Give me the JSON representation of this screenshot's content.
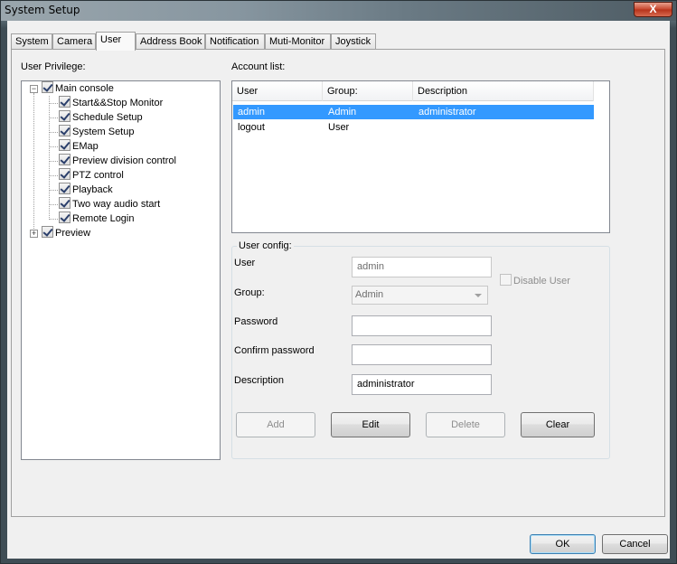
{
  "window": {
    "title": "System Setup",
    "close_glyph": "X"
  },
  "tabs": [
    {
      "label": "System"
    },
    {
      "label": "Camera"
    },
    {
      "label": "User"
    },
    {
      "label": "Address Book"
    },
    {
      "label": "Notification"
    },
    {
      "label": "Muti-Monitor"
    },
    {
      "label": "Joystick"
    }
  ],
  "privilege": {
    "label": "User Privilege:",
    "root": {
      "label": "Main console",
      "expander": "−"
    },
    "children": [
      "Start&&Stop Monitor",
      "Schedule Setup",
      "System Setup",
      "EMap",
      "Preview division control",
      "PTZ control",
      "Playback",
      "Two way audio start",
      "Remote Login"
    ],
    "preview": {
      "label": "Preview",
      "expander": "+"
    }
  },
  "accounts": {
    "label": "Account list:",
    "columns": [
      "User",
      "Group:",
      "Description"
    ],
    "rows": [
      {
        "user": "admin",
        "group": "Admin",
        "description": "administrator"
      },
      {
        "user": "logout",
        "group": "User",
        "description": ""
      }
    ]
  },
  "config": {
    "title": "User config:",
    "user_label": "User",
    "user_value": "admin",
    "disable_user_label": "Disable User",
    "group_label": "Group:",
    "group_value": "Admin",
    "password_label": "Password",
    "confirm_label": "Confirm password",
    "description_label": "Description",
    "description_value": "administrator",
    "buttons": {
      "add": "Add",
      "edit": "Edit",
      "delete": "Delete",
      "clear": "Clear"
    }
  },
  "footer": {
    "ok": "OK",
    "cancel": "Cancel"
  }
}
